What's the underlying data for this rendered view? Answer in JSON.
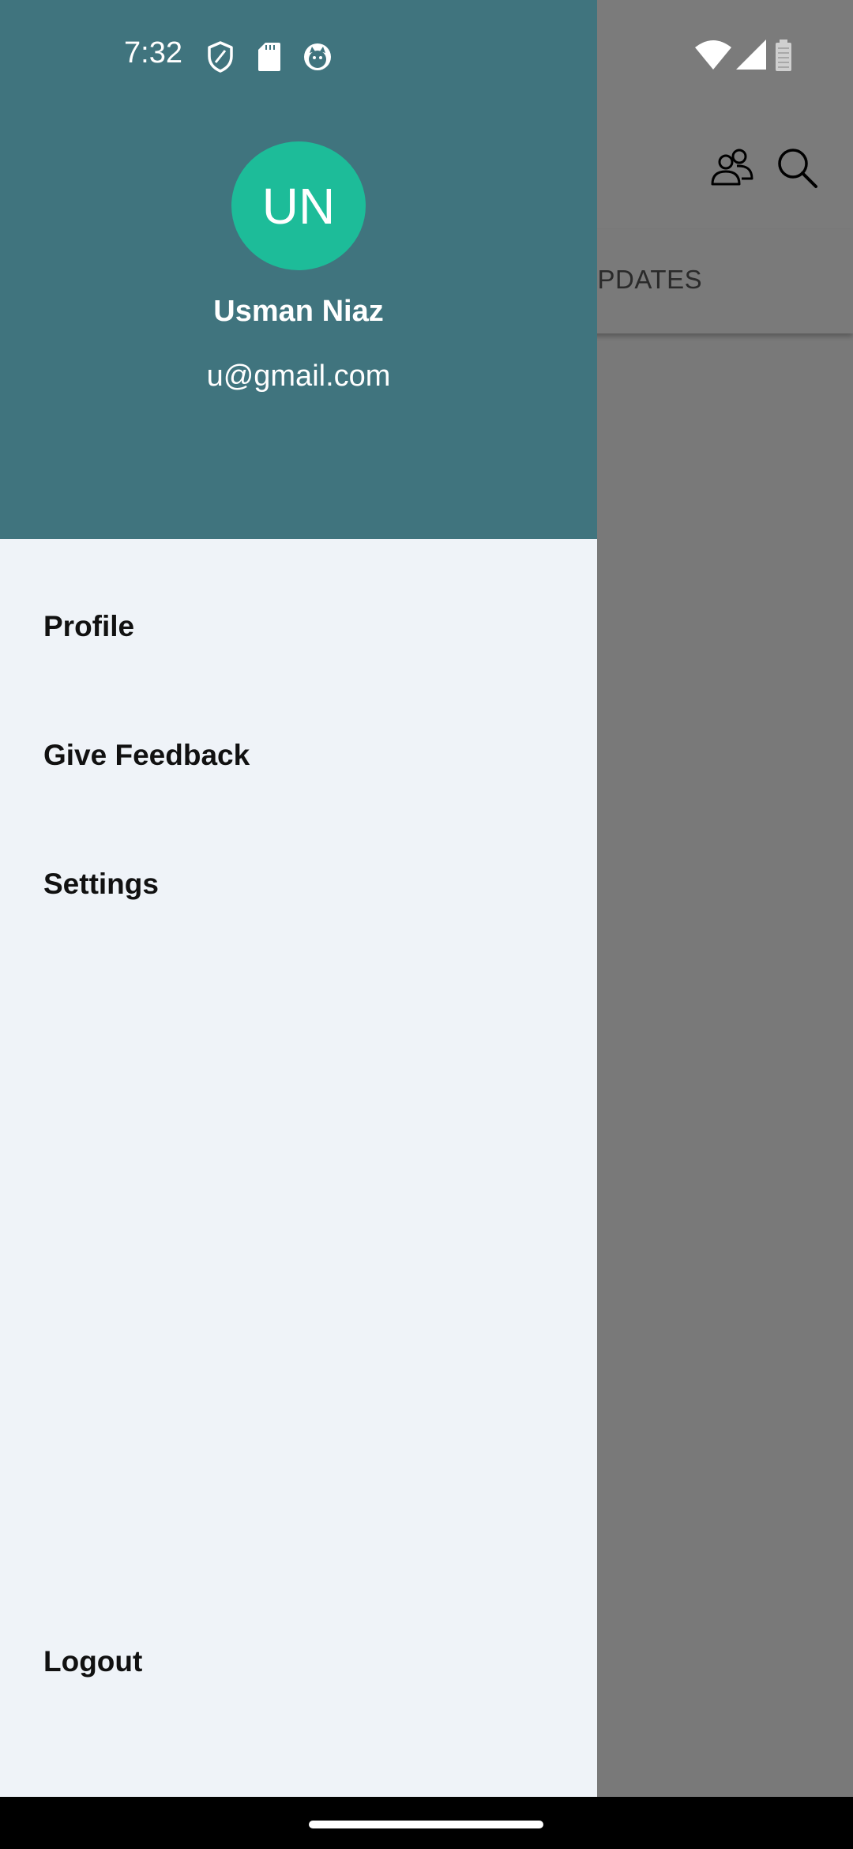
{
  "status_bar": {
    "time": "7:32",
    "left_icons": [
      "shield-icon",
      "sdcard-icon",
      "cat-icon"
    ],
    "right_icons": [
      "wifi-icon",
      "signal-icon",
      "battery-icon"
    ]
  },
  "background_app": {
    "toolbar_icons": [
      "people-icon",
      "search-icon"
    ],
    "visible_tab_label": "S UPDATES"
  },
  "drawer": {
    "header": {
      "avatar_initials": "UN",
      "user_name": "Usman Niaz",
      "user_email": "u@gmail.com"
    },
    "menu": {
      "profile": "Profile",
      "give_feedback": "Give Feedback",
      "settings": "Settings",
      "logout": "Logout"
    }
  },
  "colors": {
    "drawer_header": "#40747e",
    "avatar": "#1dbc99",
    "drawer_background": "#eff3f8",
    "scrim": "#7a7a7a"
  }
}
